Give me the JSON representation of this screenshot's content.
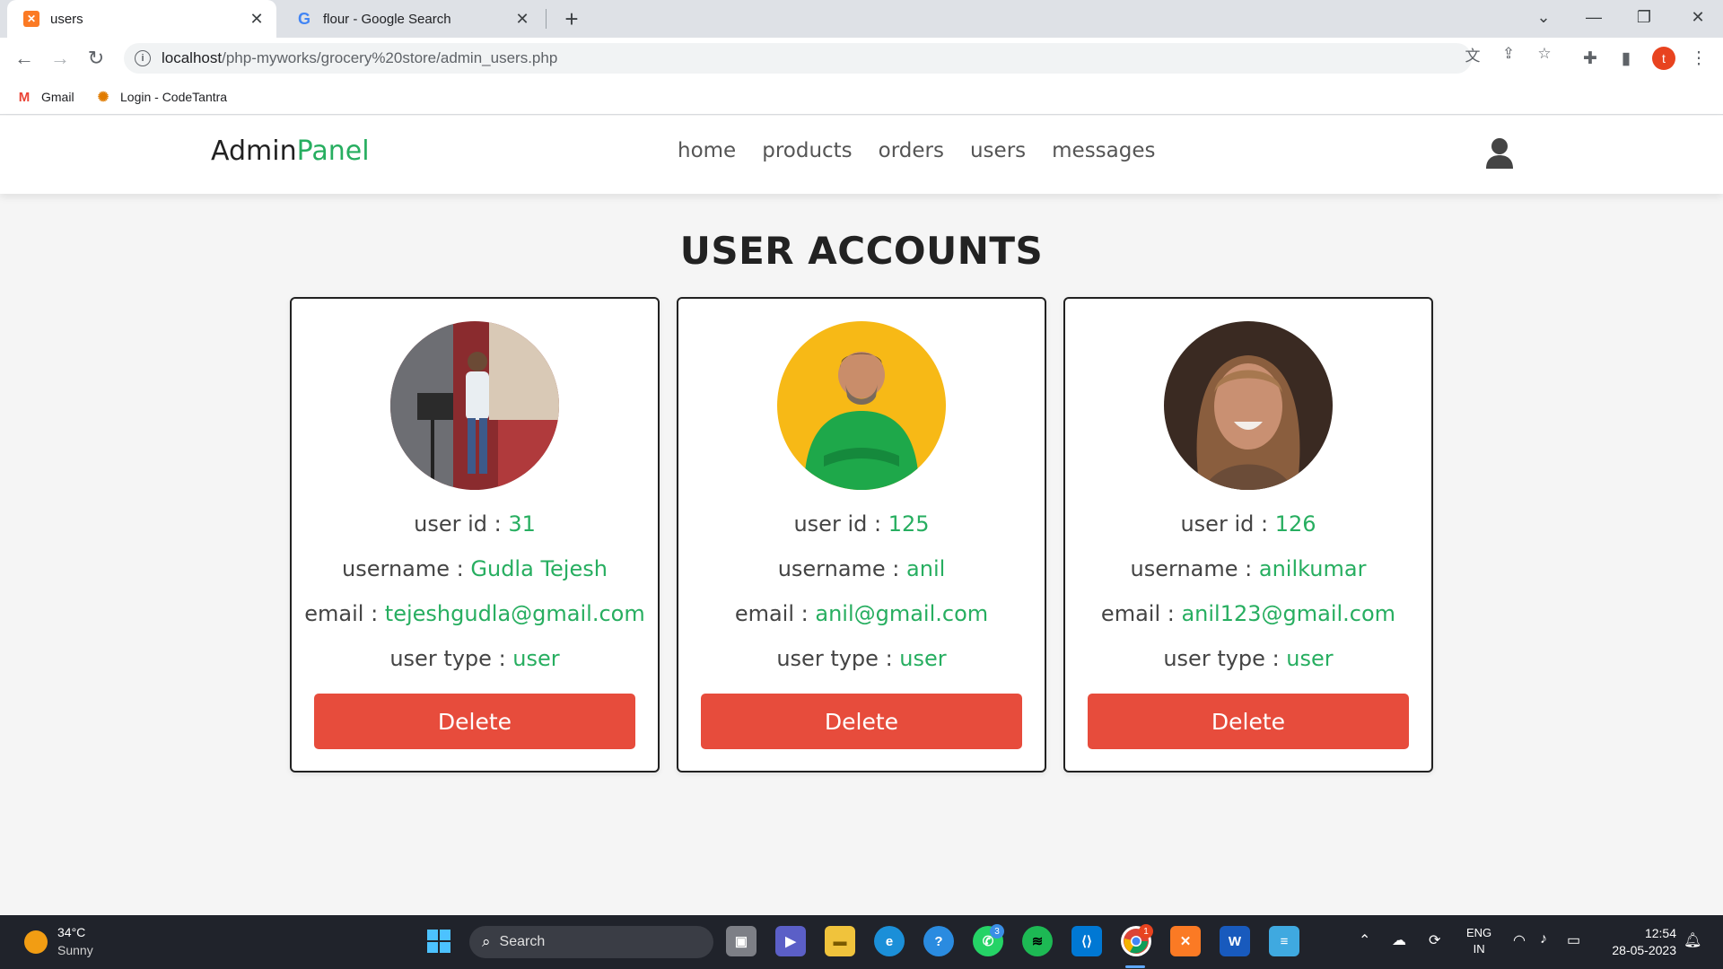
{
  "browser": {
    "tabs": [
      {
        "title": "users",
        "active": true,
        "favicon": "xampp-icon"
      },
      {
        "title": "flour - Google Search",
        "active": false,
        "favicon": "google-icon"
      }
    ],
    "url_host": "localhost",
    "url_path": "/php-myworks/grocery%20store/admin_users.php",
    "profile_initial": "t",
    "bookmarks": [
      {
        "label": "Gmail",
        "icon": "gmail-icon"
      },
      {
        "label": "Login - CodeTantra",
        "icon": "codetantra-icon"
      }
    ]
  },
  "site": {
    "logo_main": "Admin",
    "logo_accent": "Panel",
    "nav": [
      "home",
      "products",
      "orders",
      "users",
      "messages"
    ]
  },
  "page_title": "USER ACCOUNTS",
  "labels": {
    "user_id": "user id : ",
    "username": "username : ",
    "email": "email : ",
    "user_type": "user type : ",
    "delete": "Delete"
  },
  "users": [
    {
      "id": "31",
      "username": "Gudla Tejesh",
      "email": "tejeshgudla@gmail.com",
      "type": "user"
    },
    {
      "id": "125",
      "username": "anil",
      "email": "anil@gmail.com",
      "type": "user"
    },
    {
      "id": "126",
      "username": "anilkumar",
      "email": "anil123@gmail.com",
      "type": "user"
    }
  ],
  "taskbar": {
    "weather_temp": "34°C",
    "weather_desc": "Sunny",
    "search_label": "Search",
    "lang_1": "ENG",
    "lang_2": "IN",
    "time": "12:54",
    "date": "28-05-2023",
    "whatsapp_badge": "3",
    "chrome_badge": "1"
  },
  "colors": {
    "accent": "#27ae60",
    "delete": "#e74c3c",
    "page_bg": "#f5f5f5"
  }
}
